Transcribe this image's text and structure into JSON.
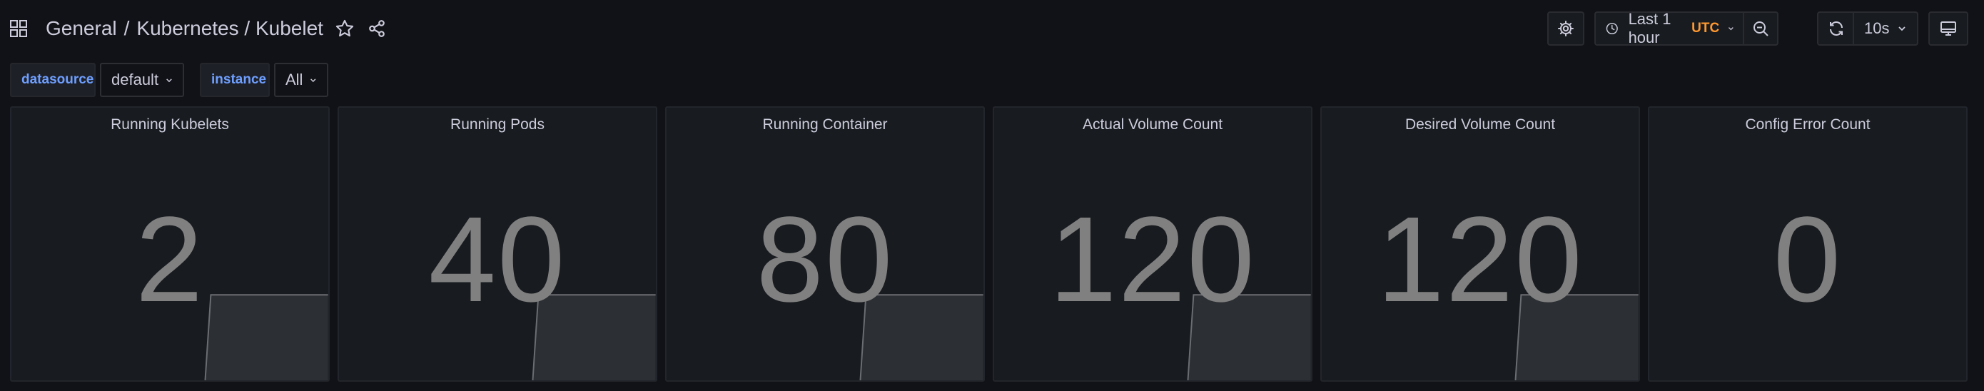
{
  "header": {
    "breadcrumb": [
      "General",
      "Kubernetes / Kubelet"
    ],
    "separator": "/",
    "icons": [
      "apps-icon",
      "star-icon",
      "share-icon"
    ]
  },
  "toolbar": {
    "settings_icon": "gear-icon",
    "time_range": "Last 1 hour",
    "timezone": "UTC",
    "zoom_icon": "zoom-out-icon",
    "refresh_icon": "refresh-icon",
    "refresh_interval": "10s",
    "tv_icon": "monitor-icon"
  },
  "variables": [
    {
      "label": "datasource",
      "value": "default"
    },
    {
      "label": "instance",
      "value": "All"
    }
  ],
  "panels": [
    {
      "title": "Running Kubelets",
      "value": "2",
      "sparkline": true
    },
    {
      "title": "Running Pods",
      "value": "40",
      "sparkline": true
    },
    {
      "title": "Running Container",
      "value": "80",
      "sparkline": true
    },
    {
      "title": "Actual Volume Count",
      "value": "120",
      "sparkline": true
    },
    {
      "title": "Desired Volume Count",
      "value": "120",
      "sparkline": true
    },
    {
      "title": "Config Error Count",
      "value": "0",
      "sparkline": false
    }
  ],
  "colors": {
    "background": "#111217",
    "panel": "#181b1f",
    "value_text": "#808080",
    "variable_label": "#6e9fff",
    "utc": "#ff9830",
    "sparkline_fill": "#2c2f33",
    "sparkline_line": "#6a6d72"
  }
}
